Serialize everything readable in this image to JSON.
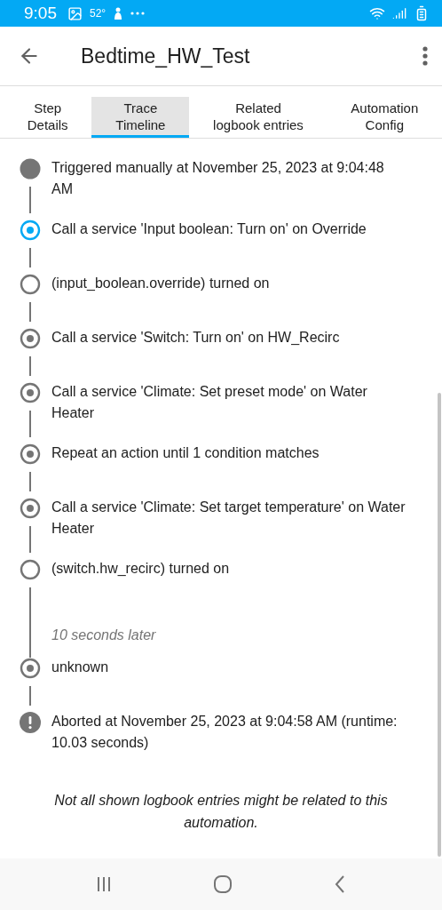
{
  "status_bar": {
    "time": "9:05",
    "temperature": "52°"
  },
  "header": {
    "title": "Bedtime_HW_Test"
  },
  "tabs": [
    {
      "label": "Step\nDetails",
      "selected": false
    },
    {
      "label": "Trace\nTimeline",
      "selected": true
    },
    {
      "label": "Related\nlogbook entries",
      "selected": false
    },
    {
      "label": "Automation\nConfig",
      "selected": false
    }
  ],
  "timeline": [
    {
      "kind": "trigger",
      "text": "Triggered manually at November 25, 2023 at 9:04:48 AM",
      "selected": false
    },
    {
      "kind": "step",
      "text": "Call a service 'Input boolean: Turn on' on Override",
      "selected": true
    },
    {
      "kind": "event",
      "text": "(input_boolean.override) turned on",
      "selected": false
    },
    {
      "kind": "step",
      "text": "Call a service 'Switch: Turn on' on HW_Recirc",
      "selected": false
    },
    {
      "kind": "step",
      "text": "Call a service 'Climate: Set preset mode' on Water Heater",
      "selected": false
    },
    {
      "kind": "step",
      "text": "Repeat an action until 1 condition matches",
      "selected": false
    },
    {
      "kind": "step",
      "text": "Call a service 'Climate: Set target temperature' on Water Heater",
      "selected": false
    },
    {
      "kind": "event",
      "text": "(switch.hw_recirc) turned on",
      "selected": false
    },
    {
      "kind": "gap",
      "text": "10 seconds later"
    },
    {
      "kind": "step",
      "text": "unknown",
      "selected": false
    },
    {
      "kind": "error",
      "text": "Aborted at November 25, 2023 at 9:04:58 AM (runtime: 10.03 seconds)",
      "selected": false
    }
  ],
  "note": "Not all shown logbook entries might be related to this automation."
}
